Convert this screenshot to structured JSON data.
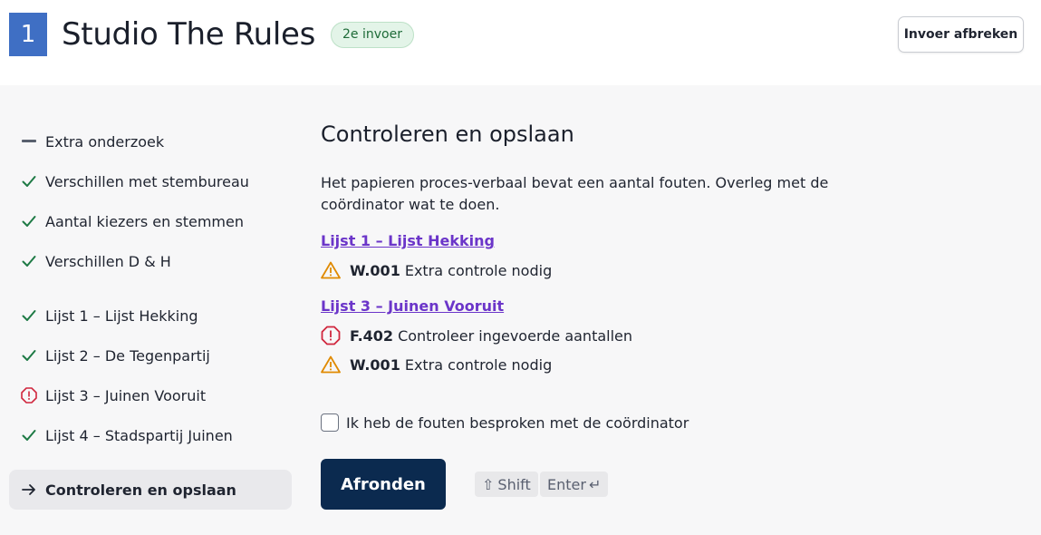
{
  "header": {
    "number": "1",
    "title": "Studio The Rules",
    "entry_badge": "2e invoer",
    "abort_label": "Invoer afbreken"
  },
  "sidebar": {
    "items": [
      {
        "label": "Extra onderzoek",
        "status": "dash"
      },
      {
        "label": "Verschillen met stembureau",
        "status": "check"
      },
      {
        "label": "Aantal kiezers en stemmen",
        "status": "check"
      },
      {
        "label": "Verschillen D & H",
        "status": "check"
      },
      {
        "label": "Lijst 1 – Lijst Hekking",
        "status": "check"
      },
      {
        "label": "Lijst 2 – De Tegenpartij",
        "status": "check"
      },
      {
        "label": "Lijst 3 – Juinen Vooruit",
        "status": "error"
      },
      {
        "label": "Lijst 4 – Stadspartij Juinen",
        "status": "check"
      },
      {
        "label": "Controleren en opslaan",
        "status": "current"
      }
    ]
  },
  "content": {
    "title": "Controleren en opslaan",
    "paragraph": "Het papieren proces-verbaal bevat een aantal fouten. Overleg met de coördinator wat te doen.",
    "groups": [
      {
        "link": "Lijst 1 – Lijst Hekking",
        "messages": [
          {
            "type": "warning",
            "code": "W.001",
            "text": "Extra controle nodig"
          }
        ]
      },
      {
        "link": "Lijst 3 – Juinen Vooruit",
        "messages": [
          {
            "type": "error",
            "code": "F.402",
            "text": "Controleer ingevoerde aantallen"
          },
          {
            "type": "warning",
            "code": "W.001",
            "text": "Extra controle nodig"
          }
        ]
      }
    ],
    "checkbox_label": "Ik heb de fouten besproken met de coördinator",
    "finish_label": "Afronden",
    "shortcut": {
      "shift": "Shift",
      "enter": "Enter"
    }
  },
  "colors": {
    "brand_blue": "#3f6fc4",
    "primary_button": "#0b2a4f",
    "link": "#6b35c9",
    "check_green": "#1e7a45",
    "error_red": "#d0263d",
    "warning_orange": "#e08a00"
  }
}
